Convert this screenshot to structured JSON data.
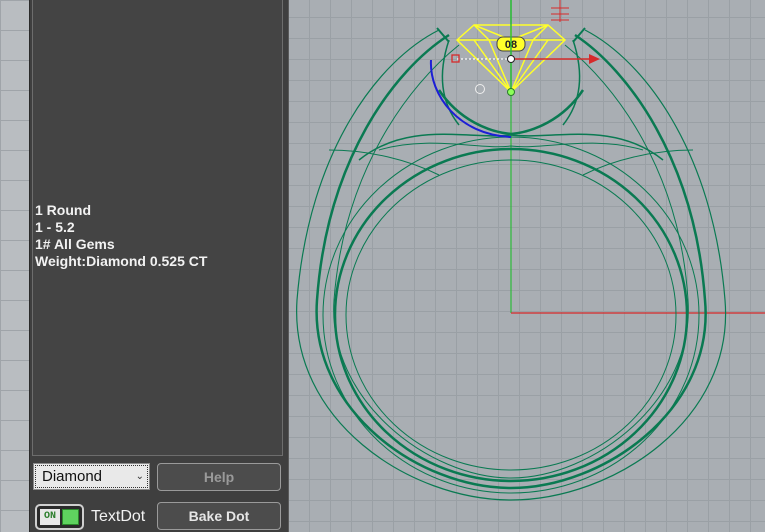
{
  "info_panel": {
    "lines": [
      "1 Round",
      "1 - 5.2",
      "",
      "1# All Gems",
      "Weight:Diamond 0.525 CT"
    ]
  },
  "material_select": {
    "value": "Diamond"
  },
  "buttons": {
    "help": "Help",
    "bake_dot": "Bake Dot"
  },
  "textdot_toggle": {
    "state_text": "ON",
    "label": "TextDot",
    "enabled": true
  },
  "viewport": {
    "gem_label": "08",
    "colors": {
      "ring": "#0a7a52",
      "gem": "#ffff2a",
      "x_axis": "#d62a2a",
      "y_axis": "#2dbb3a",
      "arc": "#1d1fd6"
    }
  }
}
